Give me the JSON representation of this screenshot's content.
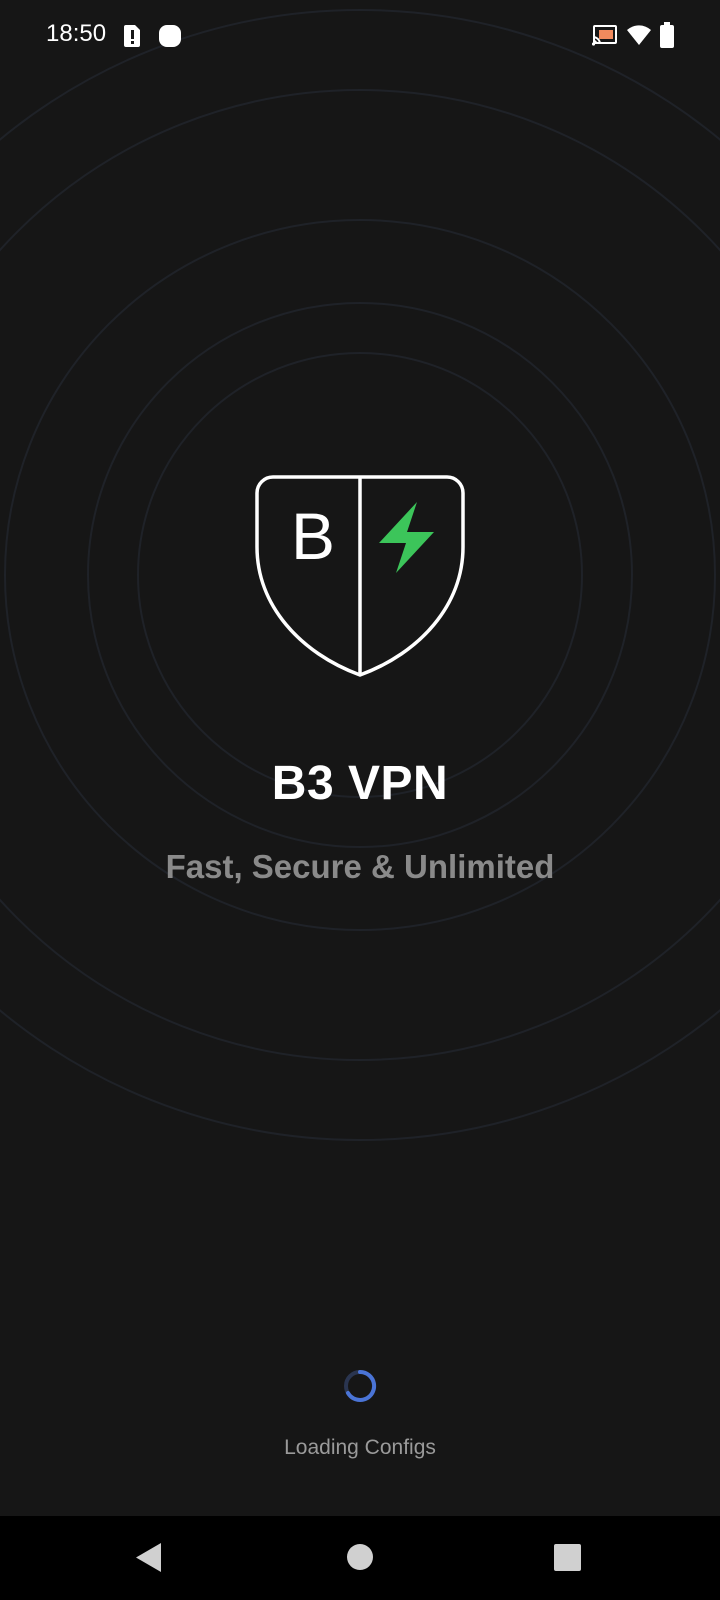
{
  "status_bar": {
    "time": "18:50",
    "left_icons": [
      "sim-alert-icon",
      "notification-dot-icon"
    ],
    "right_icons": [
      "cast-icon",
      "wifi-icon",
      "battery-icon"
    ],
    "cast_color": "#f08a5d"
  },
  "app": {
    "logo_letter": "B",
    "title": "B3 VPN",
    "tagline": "Fast, Secure & Unlimited",
    "accent_color": "#3cc55a",
    "background_color": "#161616"
  },
  "loading": {
    "text": "Loading Configs",
    "spinner_color": "#4a74d6"
  },
  "nav_bar": {
    "buttons": [
      "back-icon",
      "home-icon",
      "recents-icon"
    ]
  }
}
